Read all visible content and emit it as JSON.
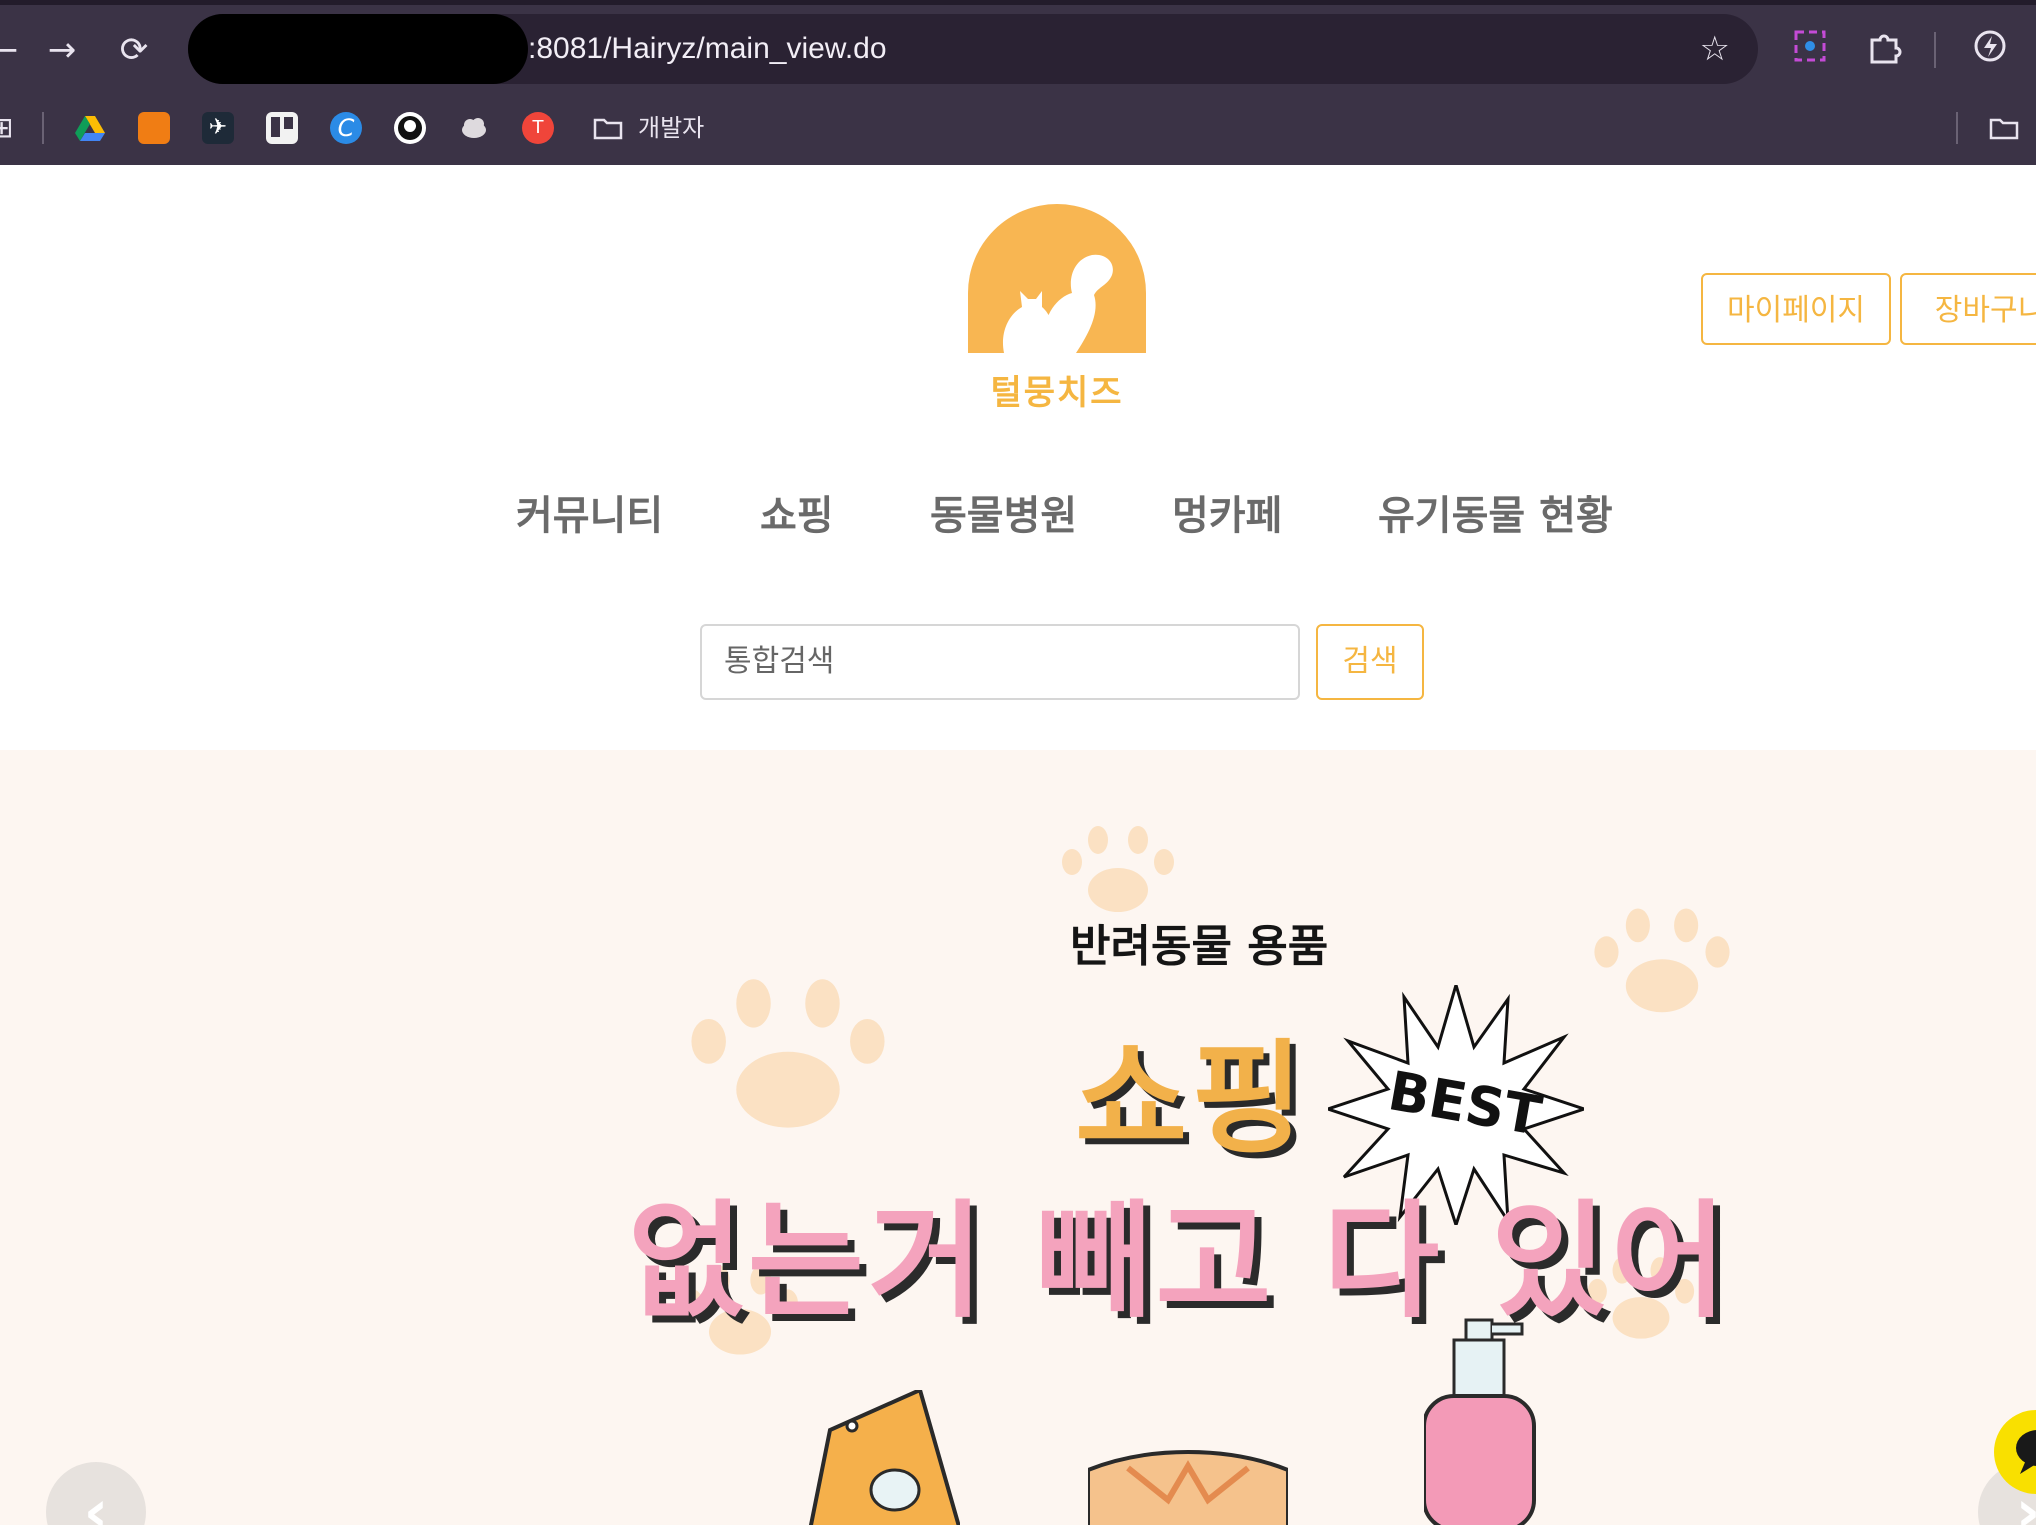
{
  "browser": {
    "url": ":8081/Hairyz/main_view.do",
    "bookmark_folder": "개발자"
  },
  "site": {
    "brand": "털뭉치즈",
    "top_buttons": {
      "mypage": "마이페이지",
      "cart": "장바구니"
    },
    "nav": [
      "커뮤니티",
      "쇼핑",
      "동물병원",
      "멍카페",
      "유기동물 현황"
    ],
    "search": {
      "placeholder": "통합검색",
      "button": "검색"
    }
  },
  "banner": {
    "subtitle": "반려동물 용품",
    "title": "쇼핑",
    "badge": "BEST",
    "headline": "없는거 빼고 다 있어"
  },
  "colors": {
    "accent": "#f5b641",
    "chrome_bg": "#3b3346",
    "banner_bg": "#fdf6f1",
    "headline_pink": "#f4a3bd"
  }
}
